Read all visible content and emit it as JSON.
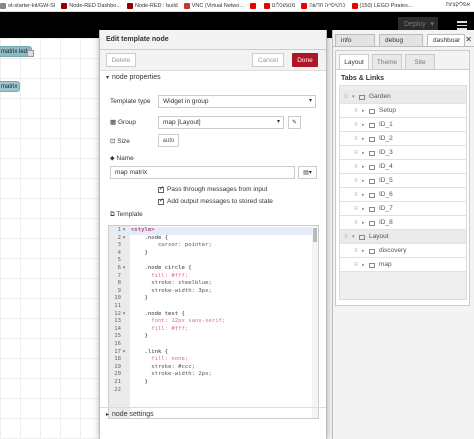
{
  "browser": {
    "bookmarks": [
      {
        "label": "ot-starter-kit/GW-SI",
        "color": "#888"
      },
      {
        "label": "Node-RED Dashbo...",
        "color": "#8f0000"
      },
      {
        "label": "Node-RED : build",
        "color": "#8f0000"
      },
      {
        "label": "VNC (Virtual Netwo...",
        "color": "#c0392b"
      },
      {
        "label": "",
        "color": "#e00"
      },
      {
        "label": "מטמוכלים",
        "color": "#e00"
      },
      {
        "label": "כרטיסייה חדשה",
        "color": "#e00"
      },
      {
        "label": "(150) LEGO Pirates...",
        "color": "#e00"
      }
    ],
    "bookmarks_right": "אפליקציות"
  },
  "header": {
    "deploy_label": "Deploy"
  },
  "workspace": {
    "nodes": [
      "matrix led",
      "matrix"
    ]
  },
  "tray": {
    "title": "Edit template node",
    "delete_label": "Delete",
    "cancel_label": "Cancel",
    "done_label": "Done",
    "properties_header": "node properties",
    "template_type_label": "Template type",
    "template_type_value": "Widget in group",
    "group_label": "Group",
    "group_value": "map [Layout]",
    "size_label": "Size",
    "size_value": "auto",
    "name_label": "Name",
    "name_value": "map matrix",
    "pass_through_label": "Pass through messages from input",
    "add_output_label": "Add output messages to stored state",
    "template_label": "Template",
    "settings_header": "node settings",
    "code_lines": [
      {
        "n": "1",
        "fold": "▾",
        "text": "<style>"
      },
      {
        "n": "2",
        "fold": "▾",
        "text": "    .node {"
      },
      {
        "n": "3",
        "fold": "",
        "text": "        cursor: pointer;"
      },
      {
        "n": "4",
        "fold": "",
        "text": "    }"
      },
      {
        "n": "5",
        "fold": "",
        "text": ""
      },
      {
        "n": "6",
        "fold": "▾",
        "text": "    .node circle {"
      },
      {
        "n": "7",
        "fold": "",
        "text": "      fill: #fff;"
      },
      {
        "n": "8",
        "fold": "",
        "text": "      stroke: steelblue;"
      },
      {
        "n": "9",
        "fold": "",
        "text": "      stroke-width: 3px;"
      },
      {
        "n": "10",
        "fold": "",
        "text": "    }"
      },
      {
        "n": "11",
        "fold": "",
        "text": ""
      },
      {
        "n": "12",
        "fold": "▾",
        "text": "    .node text {"
      },
      {
        "n": "13",
        "fold": "",
        "text": "      font: 12px sans-serif;"
      },
      {
        "n": "14",
        "fold": "",
        "text": "      fill: #fff;"
      },
      {
        "n": "15",
        "fold": "",
        "text": "    }"
      },
      {
        "n": "16",
        "fold": "",
        "text": ""
      },
      {
        "n": "17",
        "fold": "▾",
        "text": "    .link {"
      },
      {
        "n": "18",
        "fold": "",
        "text": "      fill: none;"
      },
      {
        "n": "19",
        "fold": "",
        "text": "      stroke: #ccc;"
      },
      {
        "n": "20",
        "fold": "",
        "text": "      stroke-width: 2px;"
      },
      {
        "n": "21",
        "fold": "",
        "text": "    }"
      },
      {
        "n": "22",
        "fold": "",
        "text": ""
      }
    ]
  },
  "sidebar": {
    "tabs": [
      "info",
      "debug",
      "dashboar"
    ],
    "inner_tabs": [
      "Layout",
      "Theme",
      "Site"
    ],
    "tree_title": "Tabs & Links",
    "tree": [
      {
        "label": "Garden",
        "type": "tab"
      },
      {
        "label": "Setup",
        "type": "group"
      },
      {
        "label": "ID_1",
        "type": "group"
      },
      {
        "label": "ID_2",
        "type": "group"
      },
      {
        "label": "ID_3",
        "type": "group"
      },
      {
        "label": "ID_4",
        "type": "group"
      },
      {
        "label": "ID_5",
        "type": "group"
      },
      {
        "label": "ID_6",
        "type": "group"
      },
      {
        "label": "ID_7",
        "type": "group"
      },
      {
        "label": "ID_8",
        "type": "group"
      },
      {
        "label": "Layout",
        "type": "tab"
      },
      {
        "label": "discovery",
        "type": "group"
      },
      {
        "label": "map",
        "type": "group"
      }
    ]
  }
}
